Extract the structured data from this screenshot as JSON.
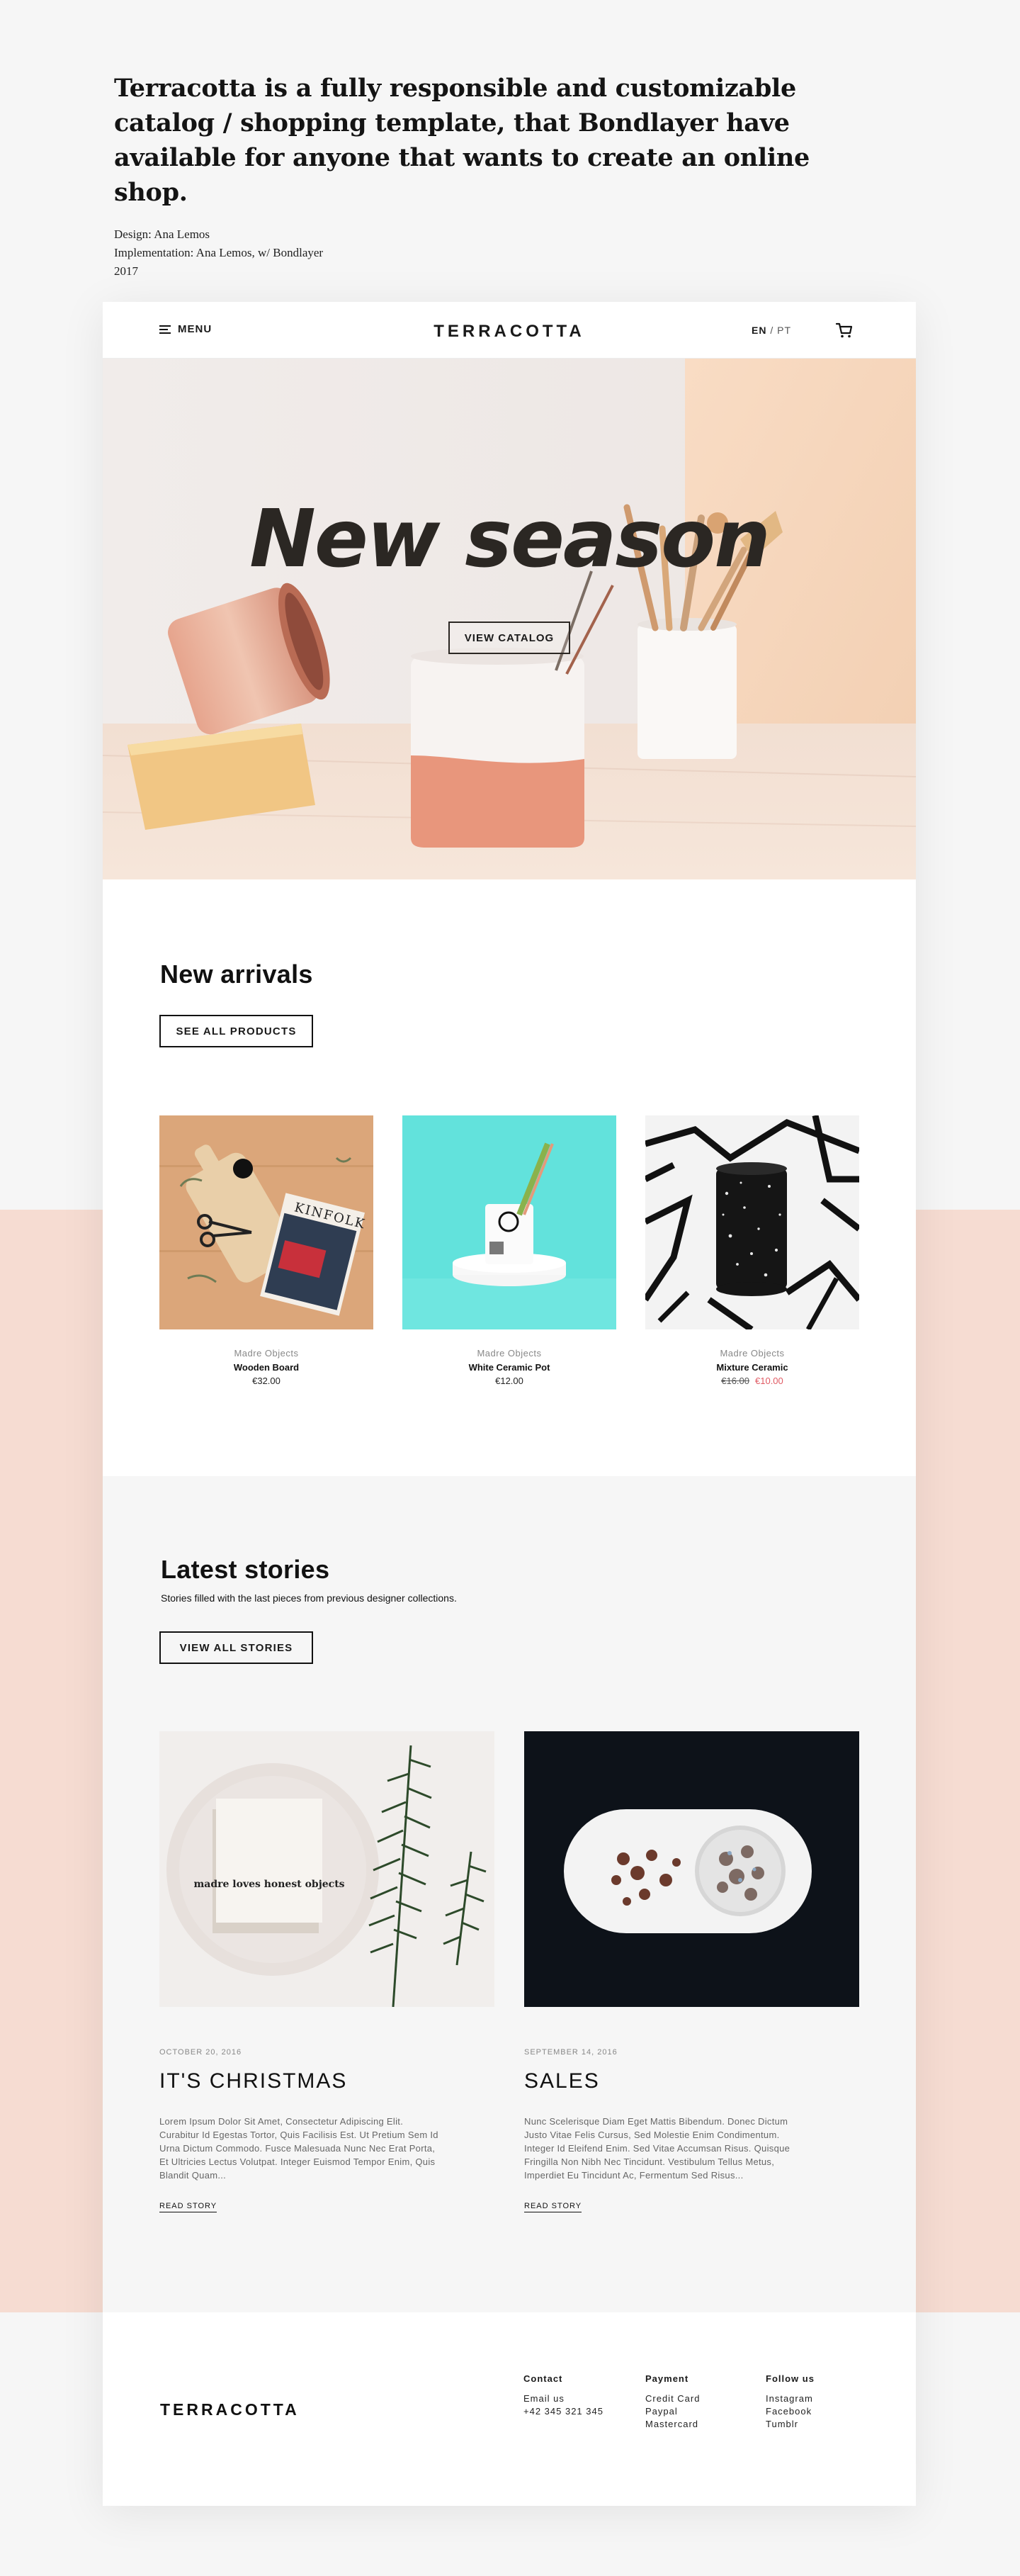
{
  "intro": {
    "headline": "Terracotta is a fully responsible and customizable catalog / shopping template, that Bondlayer have available for anyone that wants to create an online shop.",
    "design": "Design: Ana Lemos",
    "implementation": "Implementation: Ana Lemos, w/ Bondlayer",
    "year": "2017"
  },
  "nav": {
    "menu_label": "MENU",
    "brand": "TERRACOTTA",
    "lang_active": "EN",
    "lang_sep": "/",
    "lang_other": "PT"
  },
  "hero": {
    "title": "New season",
    "cta": "VIEW CATALOG"
  },
  "arrivals": {
    "title": "New arrivals",
    "cta": "SEE ALL PRODUCTS",
    "products": [
      {
        "brand": "Madre Objects",
        "name": "Wooden Board",
        "price": "€32.00"
      },
      {
        "brand": "Madre Objects",
        "name": "White Ceramic Pot",
        "price": "€12.00"
      },
      {
        "brand": "Madre Objects",
        "name": "Mixture Ceramic",
        "old_price": "€16.00",
        "price": "€10.00"
      }
    ],
    "magazine_title": "KINFOLK"
  },
  "stories": {
    "title": "Latest stories",
    "subtitle": "Stories filled with the last pieces from previous designer collections.",
    "cta": "VIEW ALL STORIES",
    "items": [
      {
        "date": "OCTOBER 20, 2016",
        "title": "IT'S CHRISTMAS",
        "body": "Lorem Ipsum Dolor Sit Amet, Consectetur Adipiscing Elit. Curabitur Id Egestas Tortor, Quis Facilisis Est. Ut Pretium Sem Id Urna Dictum Commodo. Fusce Malesuada Nunc Nec Erat Porta, Et Ultricies Lectus Volutpat. Integer Euismod Tempor Enim, Quis Blandit Quam...",
        "more": "READ STORY",
        "card_text": "madre loves honest objects"
      },
      {
        "date": "SEPTEMBER 14, 2016",
        "title": "SALES",
        "body": "Nunc Scelerisque Diam Eget Mattis Bibendum. Donec Dictum Justo Vitae Felis Cursus, Sed Molestie Enim Condimentum. Integer Id Eleifend Enim. Sed Vitae Accumsan Risus. Quisque Fringilla Non Nibh Nec Tincidunt. Vestibulum Tellus Metus, Imperdiet Eu Tincidunt Ac, Fermentum Sed Risus...",
        "more": "READ STORY"
      }
    ]
  },
  "footer": {
    "brand": "TERRACOTTA",
    "contact": {
      "heading": "Contact",
      "lines": [
        "Email us",
        "+42 345 321 345"
      ]
    },
    "payment": {
      "heading": "Payment",
      "lines": [
        "Credit Card",
        "Paypal",
        "Mastercard"
      ]
    },
    "follow": {
      "heading": "Follow us",
      "links": [
        "Instagram",
        "Facebook",
        "Tumblr"
      ]
    }
  },
  "colors": {
    "page_bg": "#f6f6f6",
    "peach": "#f6dcd2",
    "sale_red": "#e05a63",
    "teal": "#62e2dc"
  }
}
